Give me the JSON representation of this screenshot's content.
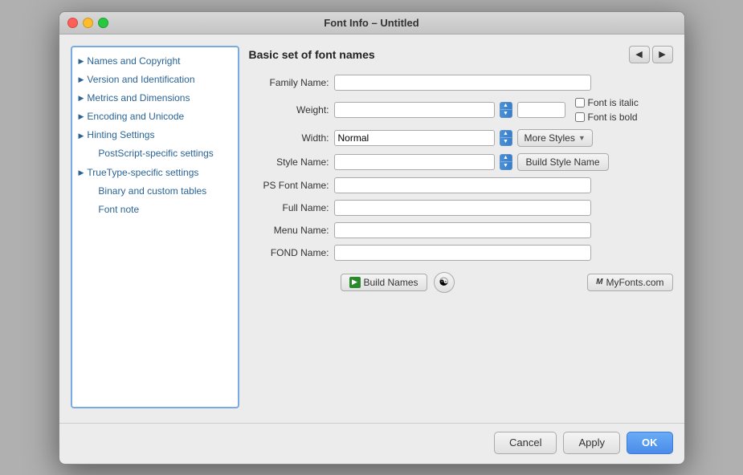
{
  "window": {
    "title": "Font Info – Untitled"
  },
  "sidebar": {
    "items": [
      {
        "id": "names-copyright",
        "label": "Names and Copyright",
        "hasArrow": true,
        "indent": false,
        "selected": true
      },
      {
        "id": "version-identification",
        "label": "Version and Identification",
        "hasArrow": true,
        "indent": false,
        "selected": false
      },
      {
        "id": "metrics-dimensions",
        "label": "Metrics and Dimensions",
        "hasArrow": true,
        "indent": false,
        "selected": false
      },
      {
        "id": "encoding-unicode",
        "label": "Encoding and Unicode",
        "hasArrow": true,
        "indent": false,
        "selected": false
      },
      {
        "id": "hinting-settings",
        "label": "Hinting Settings",
        "hasArrow": true,
        "indent": false,
        "selected": false
      },
      {
        "id": "postscript-settings",
        "label": "PostScript-specific settings",
        "hasArrow": false,
        "indent": true,
        "selected": false
      },
      {
        "id": "truetype-settings",
        "label": "TrueType-specific settings",
        "hasArrow": true,
        "indent": false,
        "selected": false
      },
      {
        "id": "binary-tables",
        "label": "Binary and custom tables",
        "hasArrow": false,
        "indent": true,
        "selected": false
      },
      {
        "id": "font-note",
        "label": "Font note",
        "hasArrow": false,
        "indent": true,
        "selected": false
      }
    ]
  },
  "main": {
    "title": "Basic set of font names",
    "nav": {
      "back_label": "◀",
      "forward_label": "▶"
    },
    "fields": {
      "family_name_label": "Family Name:",
      "family_name_value": "",
      "weight_label": "Weight:",
      "weight_value": "",
      "weight_small_value": "",
      "font_is_italic_label": "Font is italic",
      "font_is_bold_label": "Font is bold",
      "width_label": "Width:",
      "width_value": "Normal",
      "more_styles_label": "More Styles",
      "style_name_label": "Style Name:",
      "style_name_value": "",
      "build_style_name_label": "Build Style Name",
      "ps_font_name_label": "PS Font Name:",
      "ps_font_name_value": "",
      "full_name_label": "Full Name:",
      "full_name_value": "",
      "menu_name_label": "Menu Name:",
      "menu_name_value": "",
      "fond_name_label": "FOND Name:",
      "fond_name_value": ""
    },
    "actions": {
      "build_names_label": "Build Names",
      "myfonts_label": "MyFonts.com"
    }
  },
  "footer": {
    "cancel_label": "Cancel",
    "apply_label": "Apply",
    "ok_label": "OK"
  }
}
